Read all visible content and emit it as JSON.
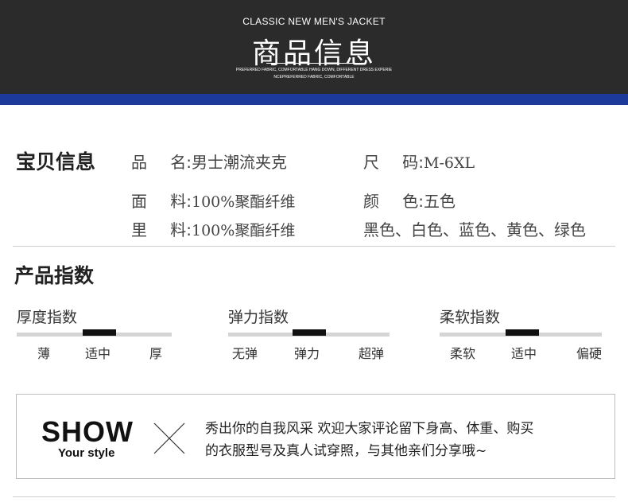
{
  "banner": {
    "title_en": "CLASSIC NEW MEN'S JACKET",
    "title_cn": "商品信息",
    "sub_line1": "PREFERRED FABRIC, COMFORTABLE HANG DOWN, DIFFERENT DRESS EXPERIE",
    "sub_line2": "NCEPREFERRED FABRIC, COMFORTABLE",
    "bar_color": "#1b3a9a"
  },
  "details": {
    "title": "宝贝信息",
    "name_key_a": "品",
    "name_key_b": "名:",
    "name_val": "男士潮流夹克",
    "size_key_a": "尺",
    "size_key_b": "码:",
    "size_val": "M-6XL",
    "fabric_key_a": "面",
    "fabric_key_b": "料:",
    "fabric_val": "100%聚酯纤维",
    "color_key_a": "颜",
    "color_key_b": "色:",
    "color_val": "五色",
    "lining_key_a": "里",
    "lining_key_b": "料:",
    "lining_val": "100%聚酯纤维",
    "colors_list": "黑色、白色、蓝色、黄色、绿色"
  },
  "indices": {
    "title": "产品指数",
    "thickness": {
      "title": "厚度指数",
      "labels": [
        "薄",
        "适中",
        "厚"
      ],
      "selected": "适中"
    },
    "elasticity": {
      "title": "弹力指数",
      "labels": [
        "无弹",
        "弹力",
        "超弹"
      ],
      "selected": "弹力"
    },
    "softness": {
      "title": "柔软指数",
      "labels": [
        "柔软",
        "适中",
        "偏硬"
      ],
      "selected": "适中"
    }
  },
  "show": {
    "big": "SHOW",
    "small": "Your style",
    "line1": "秀出你的自我风采  欢迎大家评论留下身高、体重、购买",
    "line2": "的衣服型号及真人试穿照，与其他亲们分享哦~"
  }
}
